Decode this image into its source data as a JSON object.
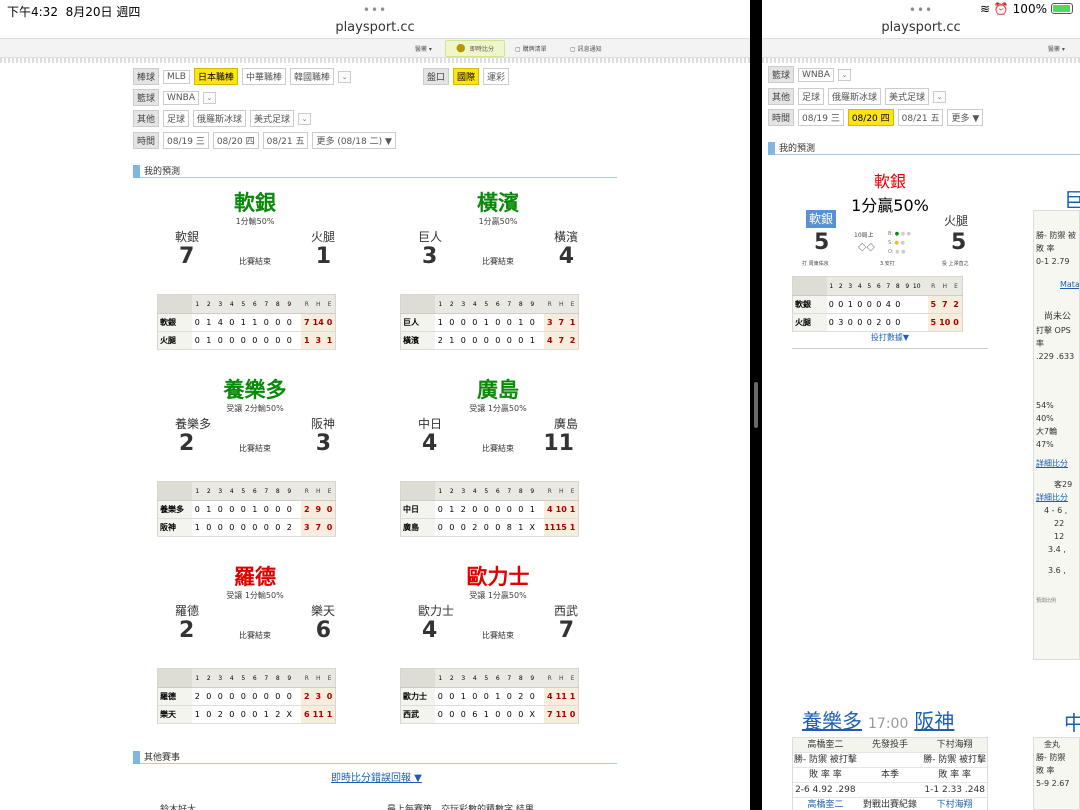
{
  "status": {
    "time": "下午4:32",
    "date": "8月20日 週四",
    "battery": "100%"
  },
  "url": "playsport.cc",
  "nav": [
    "醫藥",
    "即時比分",
    "購牌清單",
    "訊息通知"
  ],
  "nav_right": "醫藥",
  "filters": {
    "baseball": {
      "label": "棒球",
      "options": [
        "MLB",
        "日本職棒",
        "中華職棒",
        "韓國職棒"
      ],
      "selected": "日本職棒"
    },
    "market": {
      "label": "盤口",
      "options": [
        "國際",
        "運彩"
      ],
      "selected": "國際"
    },
    "basketball": {
      "label": "籃球",
      "options": [
        "WNBA"
      ]
    },
    "other": {
      "label": "其他",
      "options": [
        "足球",
        "俄羅斯冰球",
        "美式足球"
      ]
    },
    "time": {
      "label": "時間",
      "options": [
        "08/19 三",
        "08/20 四",
        "08/21 五",
        "更多 (08/18 二) ▼"
      ]
    },
    "time_right": [
      "08/19 三",
      "08/20 四",
      "08/21 五",
      "更多 ▼"
    ]
  },
  "sections": {
    "my_pred": "我的預測",
    "other_games": "其他賽事"
  },
  "live_link": "即時比分錯誤回報 ▼",
  "inning_header": [
    "1",
    "2",
    "3",
    "4",
    "5",
    "6",
    "7",
    "8",
    "9"
  ],
  "rhe_header": [
    "R",
    "H",
    "E"
  ],
  "games": [
    {
      "pick": "軟銀",
      "pick_color": "#0a8a0a",
      "pred": "1分輸50%",
      "away": "軟銀",
      "home": "火腿",
      "away_score": "7",
      "home_score": "1",
      "status": "比賽結束",
      "lines": [
        {
          "team": "軟銀",
          "inn": [
            "0",
            "1",
            "4",
            "0",
            "1",
            "1",
            "0",
            "0",
            "0"
          ],
          "rhe": [
            "7",
            "14",
            "0"
          ]
        },
        {
          "team": "火腿",
          "inn": [
            "0",
            "1",
            "0",
            "0",
            "0",
            "0",
            "0",
            "0",
            "0"
          ],
          "rhe": [
            "1",
            "3",
            "1"
          ]
        }
      ]
    },
    {
      "pick": "橫濱",
      "pick_color": "#0a8a0a",
      "pred": "1分贏50%",
      "away": "巨人",
      "home": "橫濱",
      "away_score": "3",
      "home_score": "4",
      "status": "比賽結束",
      "lines": [
        {
          "team": "巨人",
          "inn": [
            "1",
            "0",
            "0",
            "0",
            "1",
            "0",
            "0",
            "1",
            "0"
          ],
          "rhe": [
            "3",
            "7",
            "1"
          ]
        },
        {
          "team": "橫濱",
          "inn": [
            "2",
            "1",
            "0",
            "0",
            "0",
            "0",
            "0",
            "0",
            "1"
          ],
          "rhe": [
            "4",
            "7",
            "2"
          ]
        }
      ]
    },
    {
      "pick": "養樂多",
      "pick_color": "#0a8a0a",
      "pred": "受讓 2分輸50%",
      "away": "養樂多",
      "home": "阪神",
      "away_score": "2",
      "home_score": "3",
      "status": "比賽結束",
      "lines": [
        {
          "team": "養樂多",
          "inn": [
            "0",
            "1",
            "0",
            "0",
            "0",
            "1",
            "0",
            "0",
            "0"
          ],
          "rhe": [
            "2",
            "9",
            "0"
          ]
        },
        {
          "team": "阪神",
          "inn": [
            "1",
            "0",
            "0",
            "0",
            "0",
            "0",
            "0",
            "0",
            "2"
          ],
          "rhe": [
            "3",
            "7",
            "0"
          ]
        }
      ]
    },
    {
      "pick": "廣島",
      "pick_color": "#0a8a0a",
      "pred": "受讓 1分贏50%",
      "away": "中日",
      "home": "廣島",
      "away_score": "4",
      "home_score": "11",
      "status": "比賽結束",
      "lines": [
        {
          "team": "中日",
          "inn": [
            "0",
            "1",
            "2",
            "0",
            "0",
            "0",
            "0",
            "0",
            "1"
          ],
          "rhe": [
            "4",
            "10",
            "1"
          ]
        },
        {
          "team": "廣島",
          "inn": [
            "0",
            "0",
            "0",
            "2",
            "0",
            "0",
            "8",
            "1",
            "X"
          ],
          "rhe": [
            "11",
            "15",
            "1"
          ]
        }
      ]
    },
    {
      "pick": "羅德",
      "pick_color": "#e00000",
      "pred": "受讓 1分輸50%",
      "away": "羅德",
      "home": "樂天",
      "away_score": "2",
      "home_score": "6",
      "status": "比賽結束",
      "lines": [
        {
          "team": "羅德",
          "inn": [
            "2",
            "0",
            "0",
            "0",
            "0",
            "0",
            "0",
            "0",
            "0"
          ],
          "rhe": [
            "2",
            "3",
            "0"
          ]
        },
        {
          "team": "樂天",
          "inn": [
            "1",
            "0",
            "2",
            "0",
            "0",
            "0",
            "1",
            "2",
            "X"
          ],
          "rhe": [
            "6",
            "11",
            "1"
          ]
        }
      ]
    },
    {
      "pick": "歐力士",
      "pick_color": "#e00000",
      "pred": "受讓 1分贏50%",
      "away": "歐力士",
      "home": "西武",
      "away_score": "4",
      "home_score": "7",
      "status": "比賽結束",
      "lines": [
        {
          "team": "歐力士",
          "inn": [
            "0",
            "0",
            "1",
            "0",
            "0",
            "1",
            "0",
            "2",
            "0"
          ],
          "rhe": [
            "4",
            "11",
            "1"
          ]
        },
        {
          "team": "西武",
          "inn": [
            "0",
            "0",
            "0",
            "6",
            "1",
            "0",
            "0",
            "0",
            "X"
          ],
          "rhe": [
            "7",
            "11",
            "0"
          ]
        }
      ]
    }
  ],
  "bottom_cut": [
    "鈴木好太",
    "最上每賽策，交玩彩數的積數字 結果"
  ],
  "right_game": {
    "pick": "軟銀",
    "pred": "1分贏50%",
    "away": "軟銀",
    "home": "火腿",
    "away_score": "5",
    "home_score": "5",
    "inning": "10局上",
    "situation": "3.安打",
    "away_batter": "打 周東佑京",
    "home_pitcher": "投 上澤直之",
    "bso": [
      "B",
      "S",
      "O"
    ],
    "inning_header": [
      "1",
      "2",
      "3",
      "4",
      "5",
      "6",
      "7",
      "8",
      "9",
      "10"
    ],
    "lines": [
      {
        "team": "軟銀",
        "inn": [
          "0",
          "0",
          "1",
          "0",
          "0",
          "0",
          "4",
          "0",
          "",
          ""
        ],
        "rhe": [
          "5",
          "7",
          "2"
        ]
      },
      {
        "team": "火腿",
        "inn": [
          "0",
          "3",
          "0",
          "0",
          "0",
          "2",
          "0",
          "0",
          "",
          ""
        ],
        "rhe": [
          "5",
          "10",
          "0"
        ]
      }
    ],
    "link": "投打數據▼"
  },
  "right_panel": {
    "title": "巨",
    "rows1": [
      "勝-  防禦  被",
      "敗   率",
      "0-1 2.79"
    ],
    "link1": "Mata",
    "label": "尚未公",
    "rows2": [
      "打擊  OPS",
      "率",
      ".229 .633"
    ],
    "rows3": [
      "54%",
      "40%",
      "大7輪",
      "47%"
    ],
    "link2": "詳細比分",
    "rows4": [
      "客29"
    ],
    "link3": "詳細比分",
    "rows5": [
      "4 - 6 ,",
      "22",
      "12",
      "3.4 ,",
      "3.6 ,"
    ],
    "foot": "預測比例",
    "bottom_title": "中",
    "bottom_rows": [
      "金丸",
      "勝-  防禦",
      "敗   率",
      "5-9 2.67"
    ]
  },
  "right_bottom": {
    "away": "養樂多",
    "time": "17:00",
    "home": "阪神",
    "head": [
      "高橋奎二",
      "先發投手",
      "下村海翔"
    ],
    "sub": [
      "勝-  防禦  被打擊",
      "",
      "勝-  防禦  被打擊"
    ],
    "sub2": [
      "敗    率    率",
      "本季",
      "敗    率    率"
    ],
    "vals": [
      "2-6  4.92  .298",
      "",
      "1-1  2.33  .248"
    ],
    "foot": [
      "高橋奎二",
      "對戰出賽紀錄",
      "下村海翔"
    ]
  }
}
